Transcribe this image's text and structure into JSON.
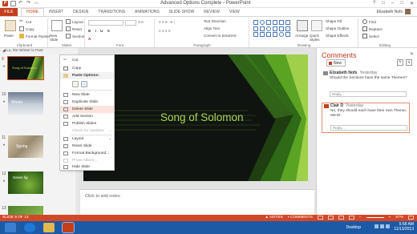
{
  "window": {
    "title": "Advanced Options Complete - PowerPoint",
    "buttons": [
      "?",
      "□",
      "–",
      "□",
      "✕"
    ]
  },
  "tabs": {
    "file": "FILE",
    "items": [
      "HOME",
      "INSERT",
      "DESIGN",
      "TRANSITIONS",
      "ANIMATIONS",
      "SLIDE SHOW",
      "REVIEW",
      "VIEW"
    ],
    "active": "HOME"
  },
  "user": {
    "name": "Elizabeth Nofs"
  },
  "ribbon": {
    "clipboard": {
      "label": "Clipboard",
      "paste": "Paste",
      "cut": "Cut",
      "copy": "Copy",
      "format_painter": "Format Painter"
    },
    "slides": {
      "label": "Slides",
      "new_slide": "New Slide",
      "layout": "Layout",
      "reset": "Reset",
      "section": "Section"
    },
    "font": {
      "label": "Font"
    },
    "paragraph": {
      "label": "Paragraph",
      "text_direction": "Text Direction",
      "align_text": "Align Text",
      "convert_smartart": "Convert to SmartArt"
    },
    "drawing": {
      "label": "Drawing",
      "arrange": "Arrange",
      "quick_styles": "Quick Styles",
      "shape_fill": "Shape Fill",
      "shape_outline": "Shape Outline",
      "shape_effects": "Shape Effects"
    },
    "editing": {
      "label": "Editing",
      "find": "Find",
      "replace": "Replace",
      "select": "Select"
    }
  },
  "section_header": "Lo, the Winter is Past",
  "thumbnails": [
    {
      "num": "9",
      "title": "Song of Solomon",
      "selected": true
    },
    {
      "num": "10",
      "title": "Winter",
      "selected": false
    },
    {
      "num": "11",
      "title": "Spring",
      "selected": false
    },
    {
      "num": "12",
      "title": "Green fig",
      "selected": false
    },
    {
      "num": "13",
      "title": "",
      "selected": false
    }
  ],
  "context_menu": {
    "cut": "Cut",
    "copy": "Copy",
    "paste_options": "Paste Options:",
    "new_slide": "New Slide",
    "duplicate_slide": "Duplicate Slide",
    "delete_slide": "Delete Slide",
    "add_section": "Add Section",
    "publish_slides": "Publish Slides",
    "check_updates": "Check for Updates",
    "layout": "Layout",
    "reset_slide": "Reset Slide",
    "format_background": "Format Background...",
    "photo_album": "Photo Album...",
    "hide_slide": "Hide Slide"
  },
  "slide": {
    "title": "Song of Solomon"
  },
  "notes": {
    "placeholder": "Click to add notes"
  },
  "comments_pane": {
    "title": "Comments",
    "new_button": "New",
    "comments": [
      {
        "author": "Elizabeth Nofs",
        "time": "Yesterday",
        "text": "Should the Sections have the same Themes?",
        "reply": "Reply..."
      },
      {
        "author": "Clair D",
        "time": "Yesterday",
        "text": "No, they should each have their own Theme, IMHO.",
        "reply": "Reply..."
      }
    ]
  },
  "status": {
    "slide": "SLIDE 9 OF 13",
    "notes": "NOTES",
    "comments": "COMMENTS",
    "zoom": "57%"
  },
  "taskbar": {
    "desktop": "Desktop",
    "time": "5:58 AM",
    "date": "11/13/2013"
  },
  "colors": {
    "accent": "#c43e1c",
    "status": "#d24726",
    "taskbar": "#1c5aa6",
    "slide_green": "#a9d356"
  }
}
